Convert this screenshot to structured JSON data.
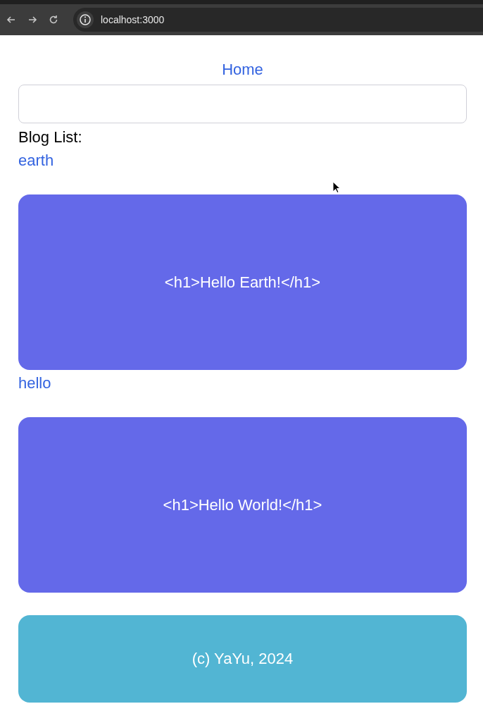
{
  "browser": {
    "url": "localhost:3000"
  },
  "nav": {
    "home_link": "Home"
  },
  "blog_list": {
    "heading": "Blog List:",
    "posts": [
      {
        "title": "earth",
        "content": "<h1>Hello Earth!</h1>"
      },
      {
        "title": "hello",
        "content": "<h1>Hello World!</h1>"
      }
    ]
  },
  "footer": {
    "text": "(c) YaYu, 2024"
  }
}
